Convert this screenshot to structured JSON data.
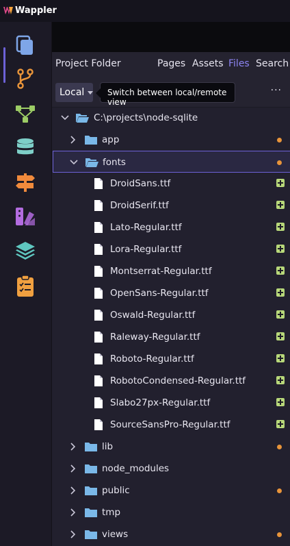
{
  "app": {
    "title": "Wappler"
  },
  "panel": {
    "title": "Project Folder",
    "tabs": [
      {
        "label": "Pages",
        "active": false
      },
      {
        "label": "Assets",
        "active": false
      },
      {
        "label": "Files",
        "active": true
      },
      {
        "label": "Search",
        "active": false
      }
    ],
    "toolbar": {
      "location_label": "Local",
      "tooltip": "Switch between local/remote view",
      "more_label": "···"
    }
  },
  "activity_bar": [
    {
      "name": "files-icon",
      "color": "#7ea6e8"
    },
    {
      "name": "git-branch-icon",
      "color": "#e8943a"
    },
    {
      "name": "workflow-icon",
      "color": "#9ccc65"
    },
    {
      "name": "database-icon",
      "color": "#7ecfc8"
    },
    {
      "name": "signpost-icon",
      "color": "#f08a3c"
    },
    {
      "name": "design-palette-icon",
      "color": "#b36ce0"
    },
    {
      "name": "layers-icon",
      "color": "#5fc7c0"
    },
    {
      "name": "clipboard-checklist-icon",
      "color": "#f0a040"
    }
  ],
  "file_tree": {
    "root": "C:\\projects\\node-sqlite",
    "items": [
      {
        "label": "app",
        "type": "folder",
        "expanded": false,
        "modified": true
      },
      {
        "label": "fonts",
        "type": "folder",
        "expanded": true,
        "modified": true,
        "selected": true,
        "children": [
          "DroidSans.ttf",
          "DroidSerif.ttf",
          "Lato-Regular.ttf",
          "Lora-Regular.ttf",
          "Montserrat-Regular.ttf",
          "OpenSans-Regular.ttf",
          "Oswald-Regular.ttf",
          "Raleway-Regular.ttf",
          "Roboto-Regular.ttf",
          "RobotoCondensed-Regular.ttf",
          "Slabo27px-Regular.ttf",
          "SourceSansPro-Regular.ttf"
        ]
      },
      {
        "label": "lib",
        "type": "folder",
        "expanded": false,
        "modified": true
      },
      {
        "label": "node_modules",
        "type": "folder",
        "expanded": false,
        "modified": false
      },
      {
        "label": "public",
        "type": "folder",
        "expanded": false,
        "modified": true
      },
      {
        "label": "tmp",
        "type": "folder",
        "expanded": false,
        "modified": false
      },
      {
        "label": "views",
        "type": "folder",
        "expanded": false,
        "modified": true
      }
    ]
  },
  "colors": {
    "accent": "#6d62d8",
    "active_tab": "#8d84f2",
    "folder": "#7ab8e8",
    "modified_dot": "#e8943a",
    "added_badge": "#b8d87a"
  }
}
